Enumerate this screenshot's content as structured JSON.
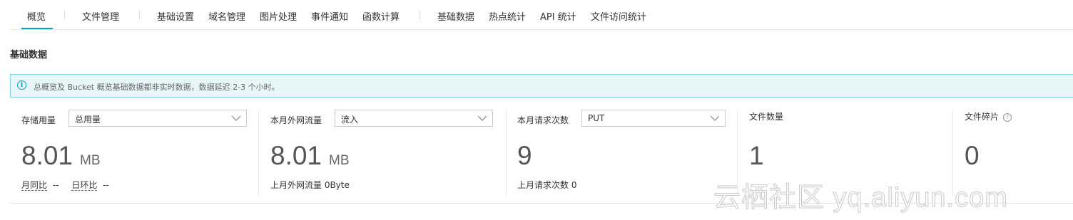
{
  "tabs": [
    {
      "label": "概览"
    },
    {
      "label": "文件管理"
    },
    {
      "label": "基础设置"
    },
    {
      "label": "域名管理"
    },
    {
      "label": "图片处理"
    },
    {
      "label": "事件通知"
    },
    {
      "label": "函数计算"
    },
    {
      "label": "基础数据"
    },
    {
      "label": "热点统计"
    },
    {
      "label": "API 统计"
    },
    {
      "label": "文件访问统计"
    }
  ],
  "accent_color": "#00a2ca",
  "section_title": "基础数据",
  "notice": {
    "icon": "info-icon",
    "text": "总概览及 Bucket 概览基础数据都非实时数据，数据延迟 2-3 个小时。"
  },
  "cards": {
    "storage": {
      "label": "存储用量",
      "select_value": "总用量",
      "value": "8.01",
      "unit": "MB",
      "yoy_label": "月同比",
      "yoy_value": "--",
      "mom_label": "日环比",
      "mom_value": "--"
    },
    "traffic": {
      "label": "本月外网流量",
      "select_value": "流入",
      "value": "8.01",
      "unit": "MB",
      "sub_text": "上月外网流量  0Byte"
    },
    "requests": {
      "label": "本月请求次数",
      "select_value": "PUT",
      "value": "9",
      "sub_text": "上月请求次数  0"
    },
    "files": {
      "label": "文件数量",
      "value": "1"
    },
    "fragments": {
      "label": "文件碎片",
      "help_icon": "question-circle-icon",
      "value": "0"
    }
  },
  "watermark": "云栖社区 yq.aliyun.com"
}
